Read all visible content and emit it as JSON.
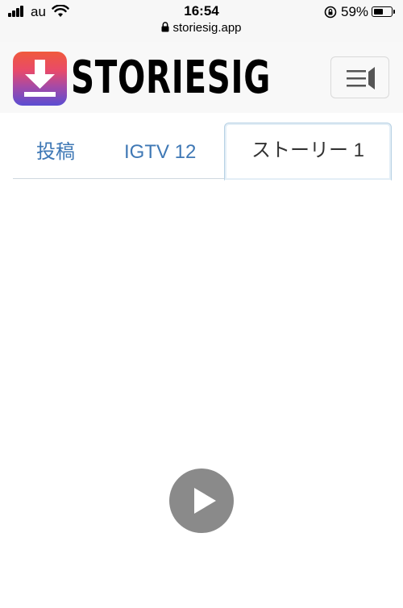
{
  "status_bar": {
    "carrier": "au",
    "time": "16:54",
    "battery_percent": "59%",
    "battery_level": 0.59,
    "url": "storiesig.app"
  },
  "header": {
    "logo_text": "STORIESIG",
    "logo_gradient": [
      "#f05a3c",
      "#e84a6a",
      "#a54aa6",
      "#5b4dd2"
    ],
    "menu_icon": "menu-icon"
  },
  "tabs": [
    {
      "label": "投稿",
      "active": false
    },
    {
      "label": "IGTV 12",
      "active": false
    },
    {
      "label": "ストーリー 1",
      "active": true
    }
  ],
  "colors": {
    "tab_link": "#3f78b5",
    "tab_active_text": "#333333",
    "play_button": "#8a8a8a"
  },
  "media": {
    "play_icon": "play-icon"
  }
}
